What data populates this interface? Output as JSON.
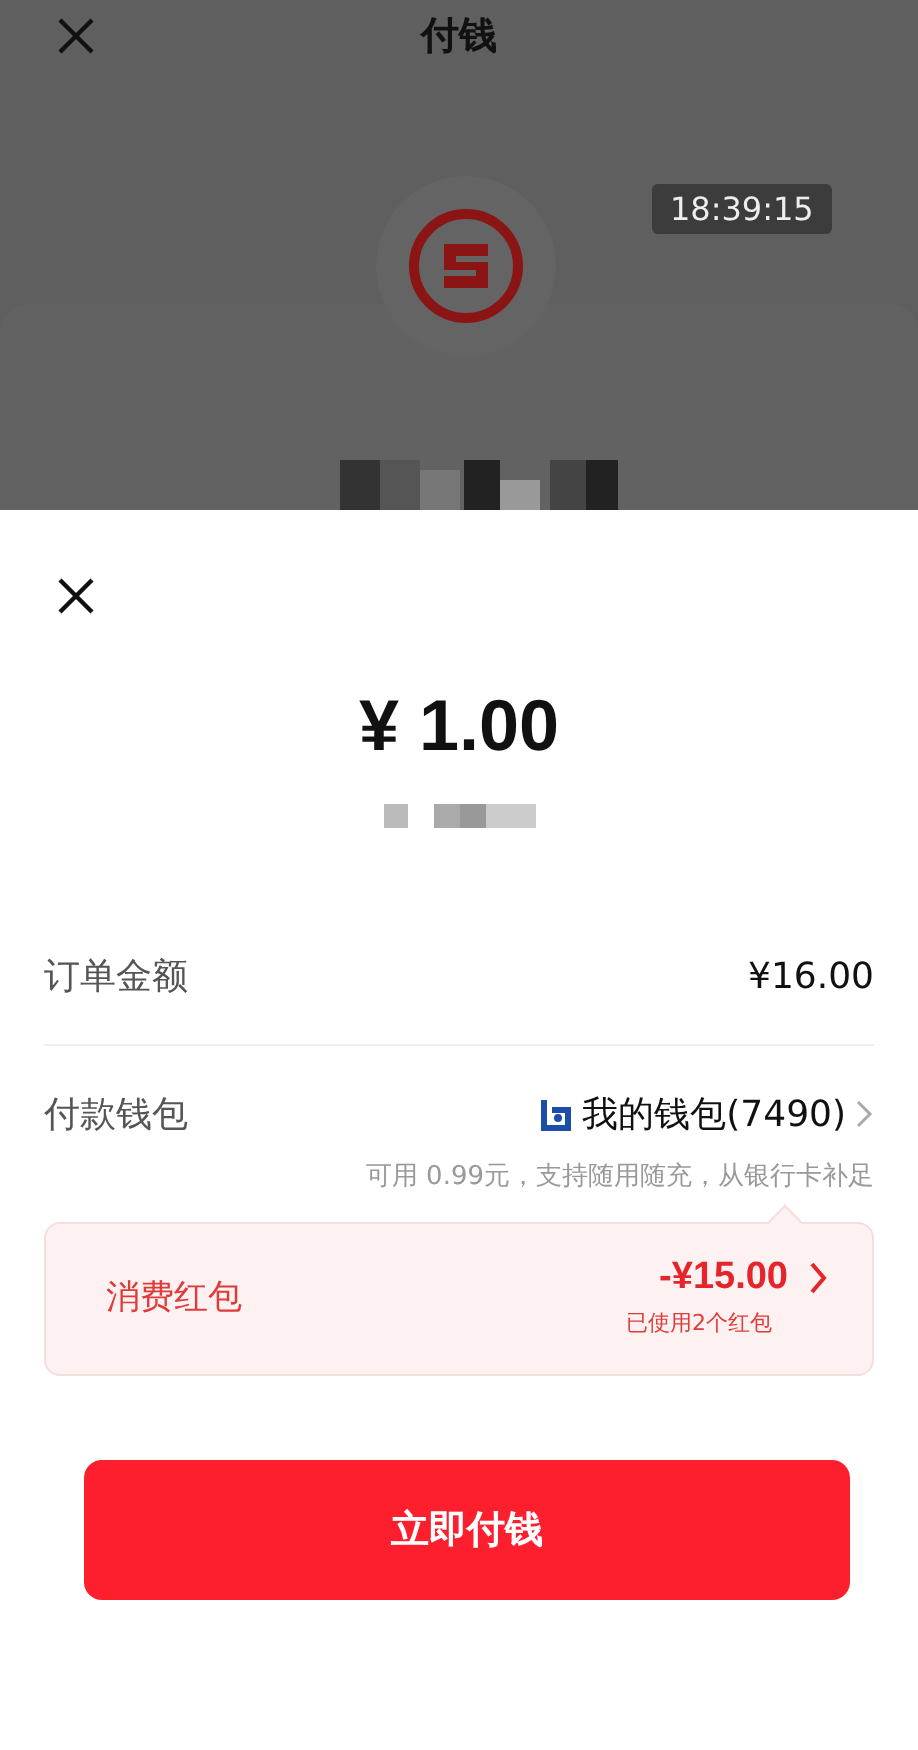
{
  "header": {
    "title": "付钱",
    "time": "18:39:15"
  },
  "sheet": {
    "amount": "¥ 1.00",
    "rows": [
      {
        "kind": "plain",
        "label": "订单金额",
        "value": "¥16.00"
      },
      {
        "kind": "wallet",
        "label": "付款钱包",
        "value": "我的钱包(7490)",
        "note": "可用 0.99元，支持随用随充，从银行卡补足"
      }
    ],
    "coupon": {
      "label": "消费红包",
      "value": "-¥15.00",
      "note": "已使用2个红包"
    },
    "pay_button": "立即付钱"
  }
}
